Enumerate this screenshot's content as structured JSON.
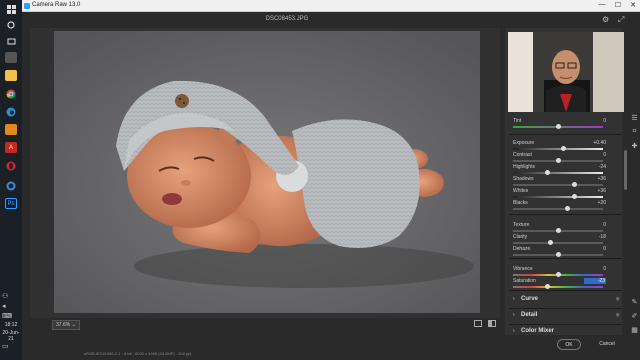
{
  "app": {
    "title": "Camera Raw 13.0",
    "filename": "DSC08453.JPG"
  },
  "window_controls": {
    "minimize": "—",
    "maximize": "☐",
    "close": "✕"
  },
  "taskbar": {
    "clock_time": "18:12",
    "clock_date": "20-Jun-21",
    "icons": [
      "windows-start",
      "search",
      "task-view",
      "file-explorer",
      "chrome",
      "edge",
      "store",
      "acrobat",
      "opera",
      "settings",
      "photoshop"
    ]
  },
  "canvas": {
    "zoom_label": "37.6% ⌄"
  },
  "basic_sliders": [
    {
      "label": "Tint",
      "value": "0",
      "pos": 0.5,
      "selected": false
    },
    {
      "label": "Exposure",
      "value": "+0.40",
      "pos": 0.55,
      "selected": false
    },
    {
      "label": "Contrast",
      "value": "0",
      "pos": 0.5,
      "selected": false
    },
    {
      "label": "Highlights",
      "value": "-24",
      "pos": 0.38,
      "selected": false
    },
    {
      "label": "Shadows",
      "value": "+36",
      "pos": 0.68,
      "selected": false
    },
    {
      "label": "Whites",
      "value": "+36",
      "pos": 0.68,
      "selected": false
    },
    {
      "label": "Blacks",
      "value": "+20",
      "pos": 0.6,
      "selected": false
    },
    {
      "label": "Texture",
      "value": "0",
      "pos": 0.5,
      "selected": false
    },
    {
      "label": "Clarity",
      "value": "-18",
      "pos": 0.41,
      "selected": false
    },
    {
      "label": "Dehaze",
      "value": "0",
      "pos": 0.5,
      "selected": false
    },
    {
      "label": "Vibrance",
      "value": "0",
      "pos": 0.5,
      "selected": false
    },
    {
      "label": "Saturation",
      "value": "-23",
      "pos": 0.38,
      "selected": true
    }
  ],
  "sections": [
    {
      "label": "Curve",
      "chevron": "›"
    },
    {
      "label": "Detail",
      "chevron": "›"
    },
    {
      "label": "Color Mixer",
      "chevron": "›"
    }
  ],
  "footer": {
    "ok_label": "OK",
    "cancel_label": "Cancel",
    "meta_text": "sRGB IEC61966-2.1 - 8 bit - 6000 x 4000 (24.0MP) - 300 ppi"
  },
  "colors": {
    "accent": "#2f6cc7",
    "panel_bg": "#323232",
    "titlebar_bg": "#f0f0f0"
  }
}
